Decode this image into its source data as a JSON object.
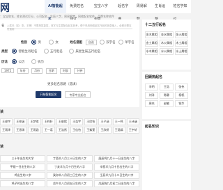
{
  "nav": {
    "logo": "网",
    "tabs": [
      "AI智能起名",
      "免费姓名测试",
      "宝宝八字测算",
      "起名字典",
      "周易解梦",
      "生肖运势",
      "姓名学知识"
    ],
    "active_index": 0
  },
  "subline": "：宝宝取名，姓名测试打分，公司起名，生辰八字，周易解梦，网络起名软件，品牌名称软件",
  "form": {
    "label_surname": "名",
    "placeholder": "入姓氏（如：张、王等）不限单姓复姓，双字与生辰配合起名参考，便于采用网络起名作品的信息输入，全程无需支付费用",
    "label_gender": "性别",
    "gender_options": [
      "男",
      "女"
    ],
    "label_mode": "姓名搭配",
    "mode_value": "自选",
    "mode_options": [
      "双字名",
      "单字名"
    ],
    "label_type": "类型",
    "type_options": [
      "智能生肖起名",
      "五行起名",
      "辰星生辰五行起名"
    ],
    "label_calendar": "历法",
    "calendar_options": [
      "公历",
      "农历"
    ],
    "birth_fields": [
      "1975",
      "年份",
      "月份",
      "日期",
      "时辰",
      "分钟"
    ],
    "more_text": "更多起名思路（选填）",
    "btn_primary": "开始智能起名",
    "btn_secondary": "专家专业起名"
  },
  "sections": {
    "hot_title": "读",
    "hot_names": [
      "王俊宇",
      "王梓涵",
      "王梦琪",
      "王梓轩",
      "王俊熙",
      "王浩宇",
      "王欣怡",
      "王子涵",
      "王一鸣",
      "王诗涵",
      "王雨泽",
      "王思琪",
      "王雨涵",
      "王一诺",
      "王浩然",
      "王佳怡",
      "王紫萱",
      "王欣妍",
      "王语嫣",
      "王宇轩"
    ],
    "lists_title": "读",
    "lists": [
      "三十年出生的大学",
      "丁酉羊八月三十日生的八字",
      "庚辰鸡九月十一日出生的八字",
      "甲辰一日出生的八字",
      "丁亥羊九月十日生的八字",
      "辛酉羊九月十日出生的八字",
      "鸡出生的八字",
      "癸卯羊八月初三日生的八字",
      "壬辰羊九月十二日生的八字",
      "鸡子时出生的八字",
      "戊午羊八月初五日生的八字",
      "戊辰狗九月初二日出生的八字"
    ]
  },
  "sidebar": {
    "wuxing_title": "十二五行起名",
    "wuxing_items": [
      "金木属相",
      "金水属相",
      "金火属相",
      "金土属相",
      "木火属相",
      "木土属相",
      "水木属相",
      "水火属相",
      "水土属相"
    ],
    "hot_title": "回顾热起名",
    "hot_items": [
      "李明",
      "王浩",
      "张伟",
      "刘洋",
      "陈静",
      "杨帆",
      "周杰",
      "赵敏",
      "钱华"
    ],
    "knowledge_title": "起名知识"
  },
  "colors": {
    "accent": "#1f3a6b",
    "background": "#f3f3f3",
    "panel": "#ffffff"
  }
}
